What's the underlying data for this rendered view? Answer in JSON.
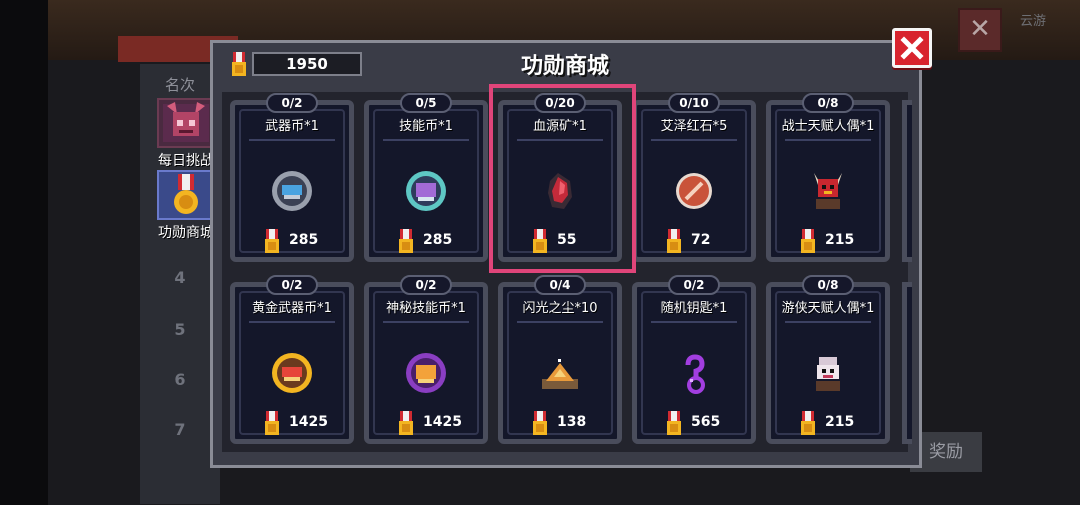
{
  "header": {
    "title": "功勋商城",
    "merit_balance": "1950",
    "corner_text": "云游"
  },
  "sidebar": {
    "rank_header": "名次",
    "tabs": [
      {
        "label": "每日挑战",
        "icon": "demon-mask-icon"
      },
      {
        "label": "功勋商城",
        "icon": "medal-icon"
      }
    ],
    "rank_numbers": [
      "4",
      "5",
      "6",
      "7"
    ]
  },
  "background": {
    "reward_button": "奖励"
  },
  "colors": {
    "highlight": "#e0457a",
    "close_button": "#d8242e",
    "medal_gold": "#f3b521",
    "medal_ribbon": "#d12b32"
  },
  "items": [
    {
      "name": "武器币*1",
      "stock": "0/2",
      "price": "285",
      "icon": "weapon-coin-icon"
    },
    {
      "name": "技能币*1",
      "stock": "0/5",
      "price": "285",
      "icon": "skill-coin-icon"
    },
    {
      "name": "血源矿*1",
      "stock": "0/20",
      "price": "55",
      "icon": "blood-ore-icon"
    },
    {
      "name": "艾泽红石*5",
      "stock": "0/10",
      "price": "72",
      "icon": "red-stone-icon"
    },
    {
      "name": "战士天赋人偶*1",
      "stock": "0/8",
      "price": "215",
      "icon": "warrior-doll-icon"
    },
    {
      "name": "黄金武器币*1",
      "stock": "0/2",
      "price": "1425",
      "icon": "gold-weapon-coin-icon"
    },
    {
      "name": "神秘技能币*1",
      "stock": "0/2",
      "price": "1425",
      "icon": "mystic-skill-coin-icon"
    },
    {
      "name": "闪光之尘*10",
      "stock": "0/4",
      "price": "138",
      "icon": "sparkle-dust-icon"
    },
    {
      "name": "随机钥匙*1",
      "stock": "0/2",
      "price": "565",
      "icon": "random-key-icon"
    },
    {
      "name": "游侠天赋人偶*1",
      "stock": "0/8",
      "price": "215",
      "icon": "ranger-doll-icon"
    }
  ]
}
